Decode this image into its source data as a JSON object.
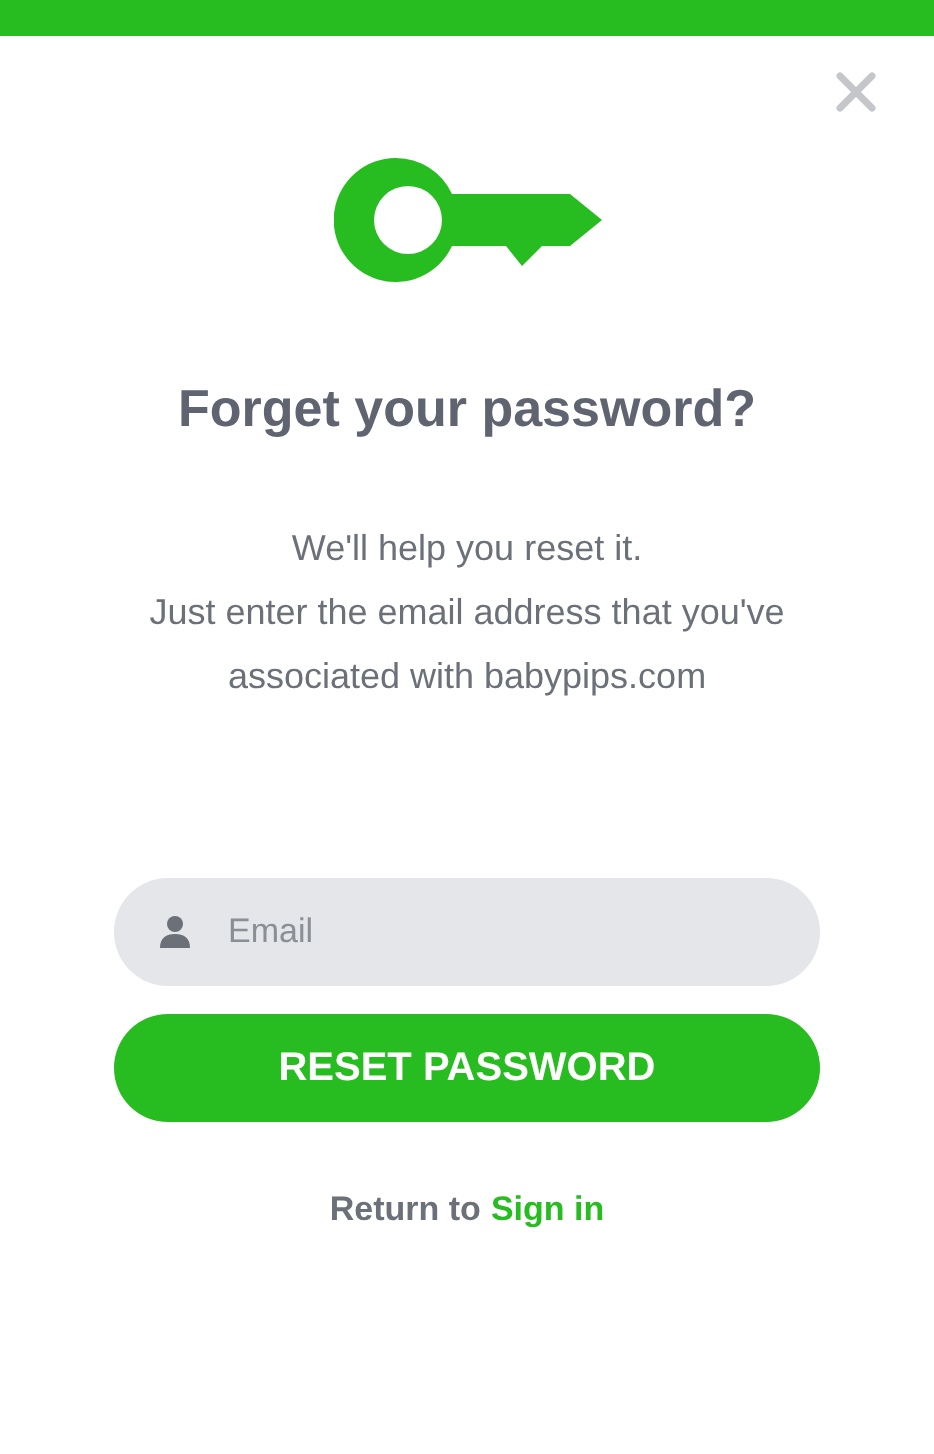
{
  "heading": "Forget your password?",
  "message_lines": [
    "We'll help you reset it.",
    "Just enter the email address that you've",
    "associated with babypips.com"
  ],
  "email_field": {
    "placeholder": "Email"
  },
  "submit_button": "RESET PASSWORD",
  "footer": {
    "prefix": "Return to",
    "link": "Sign in"
  }
}
